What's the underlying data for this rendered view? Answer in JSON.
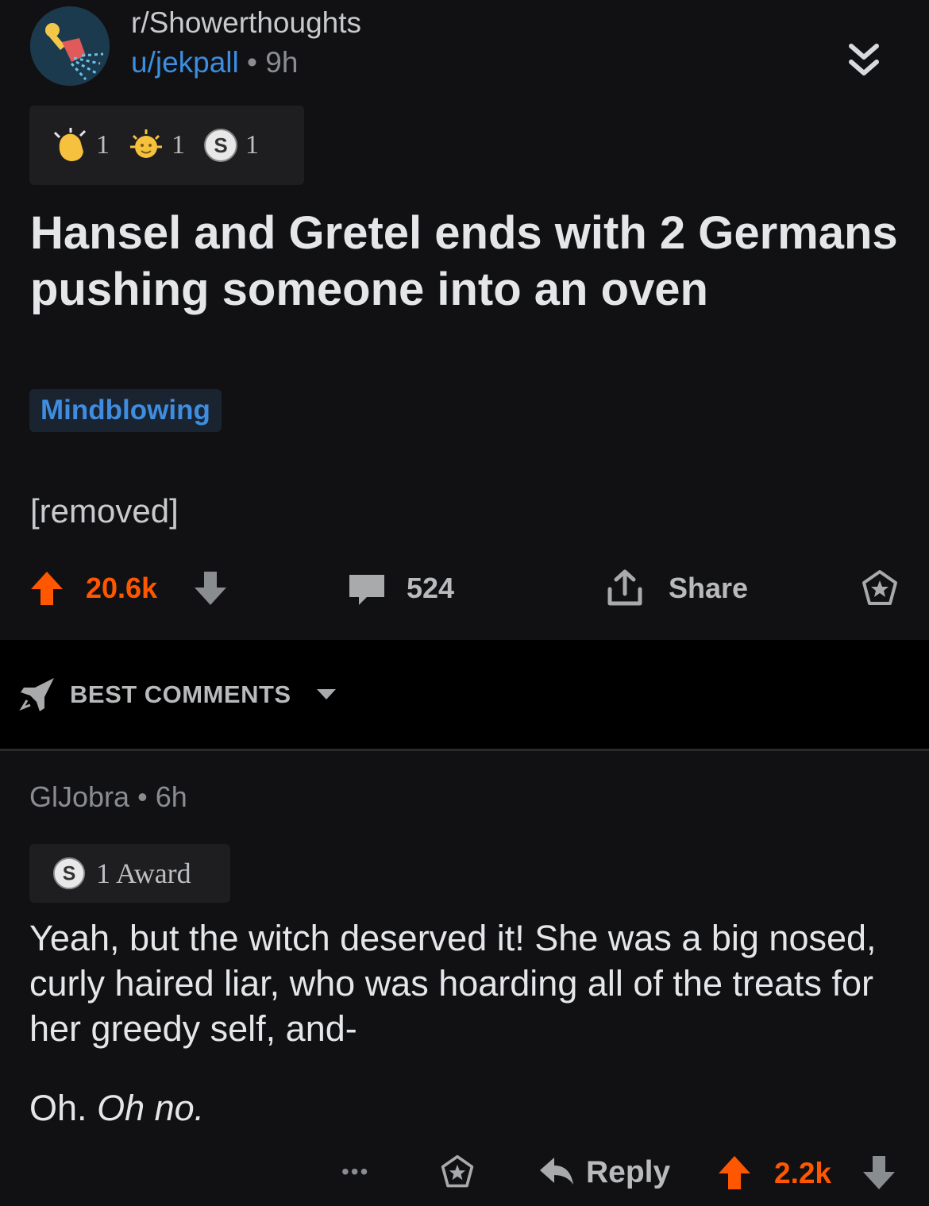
{
  "post": {
    "subreddit": "r/Showerthoughts",
    "author": "u/jekpall",
    "dot": "•",
    "age": "9h",
    "awards": [
      {
        "icon": "wholesome-clap-icon",
        "count": "1"
      },
      {
        "icon": "gold-face-icon",
        "count": "1"
      },
      {
        "icon": "silver-s-icon",
        "count": "1"
      }
    ],
    "title": "Hansel and Gretel ends with 2 Germans pushing someone into an oven",
    "flair": "Mindblowing",
    "body": "[removed]",
    "score": "20.6k",
    "comments": "524",
    "share_label": "Share"
  },
  "sort": {
    "label": "BEST COMMENTS"
  },
  "comment": {
    "author": "GlJobra",
    "dot": "•",
    "age": "6h",
    "award_text": "1 Award",
    "body_1": "Yeah, but the witch deserved it! She was a big nosed, curly haired liar, who was hoarding all of the treats for her greedy self, and-",
    "body_2a": "Oh.",
    "body_2b": "Oh no.",
    "more": "•••",
    "reply_label": "Reply",
    "score": "2.2k"
  },
  "colors": {
    "background": "#111114",
    "upvote": "#ff5700",
    "link": "#3b8ee0"
  }
}
